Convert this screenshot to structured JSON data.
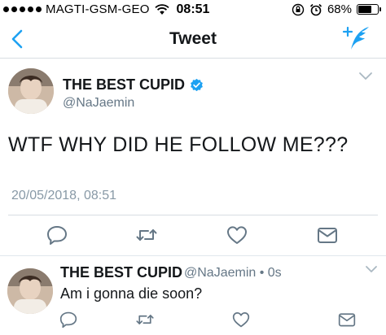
{
  "status_bar": {
    "carrier": "MAGTI-GSM-GEO",
    "time": "08:51",
    "battery": "68%",
    "battery_level": 0.68
  },
  "nav": {
    "title": "Tweet"
  },
  "tweet": {
    "display_name": "THE BEST CUPID",
    "handle": "@NaJaemin",
    "text": "WTF WHY DID HE FOLLOW ME???",
    "timestamp": "20/05/2018, 08:51"
  },
  "reply": {
    "display_name": "THE BEST CUPID",
    "handle_time": "@NaJaemin • 0s",
    "text": "Am i gonna die soon?"
  },
  "colors": {
    "accent": "#1da1f2",
    "icon_gray": "#657786",
    "divider": "#d8dde2"
  },
  "icons": {
    "reply": "reply-icon",
    "retweet": "retweet-icon",
    "like": "heart-icon",
    "dm": "envelope-icon"
  }
}
